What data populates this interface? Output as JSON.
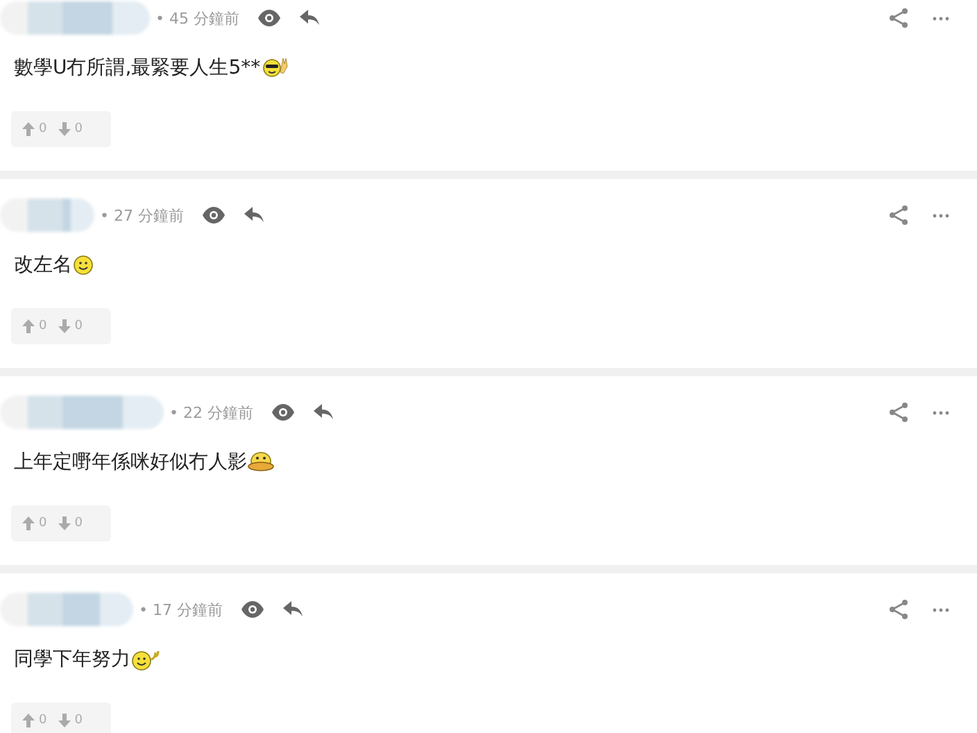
{
  "posts": [
    {
      "time": "• 45 分鐘前",
      "text": "數學U冇所謂,最緊要人生5**",
      "kind": "cool",
      "upvotes": "0",
      "downvotes": "0"
    },
    {
      "time": "• 27 分鐘前",
      "text": "改左名",
      "kind": "smile",
      "upvotes": "0",
      "downvotes": "0"
    },
    {
      "time": "• 22 分鐘前",
      "text": "上年定嘢年係咪好似冇人影",
      "kind": "duck",
      "upvotes": "0",
      "downvotes": "0"
    },
    {
      "time": "• 17 分鐘前",
      "text": "同學下年努力",
      "kind": "wave",
      "upvotes": "0",
      "downvotes": "0"
    }
  ]
}
